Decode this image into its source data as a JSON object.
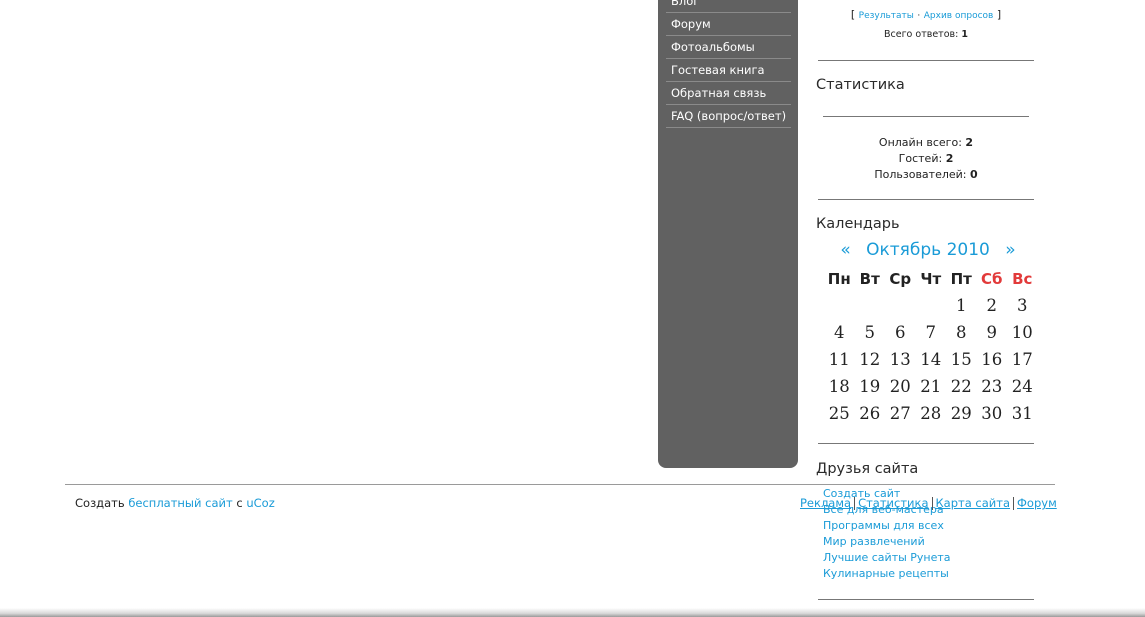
{
  "menu": {
    "items": [
      "Блог",
      "Форум",
      "Фотоальбомы",
      "Гостевая книга",
      "Обратная связь",
      "FAQ (вопрос/ответ)"
    ]
  },
  "poll": {
    "bracket_open": "[",
    "results_link": "Результаты",
    "dot": "·",
    "archive_link": "Архив опросов",
    "bracket_close": "]",
    "total_label": "Всего ответов:",
    "total_value": "1"
  },
  "stats": {
    "title": "Статистика",
    "online_label": "Онлайн всего:",
    "online_value": "2",
    "guests_label": "Гостей:",
    "guests_value": "2",
    "users_label": "Пользователей:",
    "users_value": "0"
  },
  "calendar": {
    "title": "Календарь",
    "prev": "«",
    "month": "Октябрь 2010",
    "next": "»",
    "weekdays": [
      "Пн",
      "Вт",
      "Ср",
      "Чт",
      "Пт",
      "Сб",
      "Вс"
    ],
    "weeks": [
      [
        "",
        "",
        "",
        "",
        "1",
        "2",
        "3"
      ],
      [
        "4",
        "5",
        "6",
        "7",
        "8",
        "9",
        "10"
      ],
      [
        "11",
        "12",
        "13",
        "14",
        "15",
        "16",
        "17"
      ],
      [
        "18",
        "19",
        "20",
        "21",
        "22",
        "23",
        "24"
      ],
      [
        "25",
        "26",
        "27",
        "28",
        "29",
        "30",
        "31"
      ]
    ],
    "weekend_color": "#e23a3a"
  },
  "friends": {
    "title": "Друзья сайта",
    "links": [
      "Создать сайт",
      "Все для веб-мастера",
      "Программы для всех",
      "Мир развлечений",
      "Лучшие сайты Рунета",
      "Кулинарные рецепты"
    ]
  },
  "footer": {
    "create_prefix": "Создать",
    "free_site_link": "бесплатный сайт",
    "with": "с",
    "ucoz_link": "uCoz",
    "links": [
      "Реклама",
      "Статистика",
      "Карта сайта",
      "Форум"
    ]
  },
  "colors": {
    "link": "#1a9bd7",
    "menu_bg": "#616161"
  }
}
